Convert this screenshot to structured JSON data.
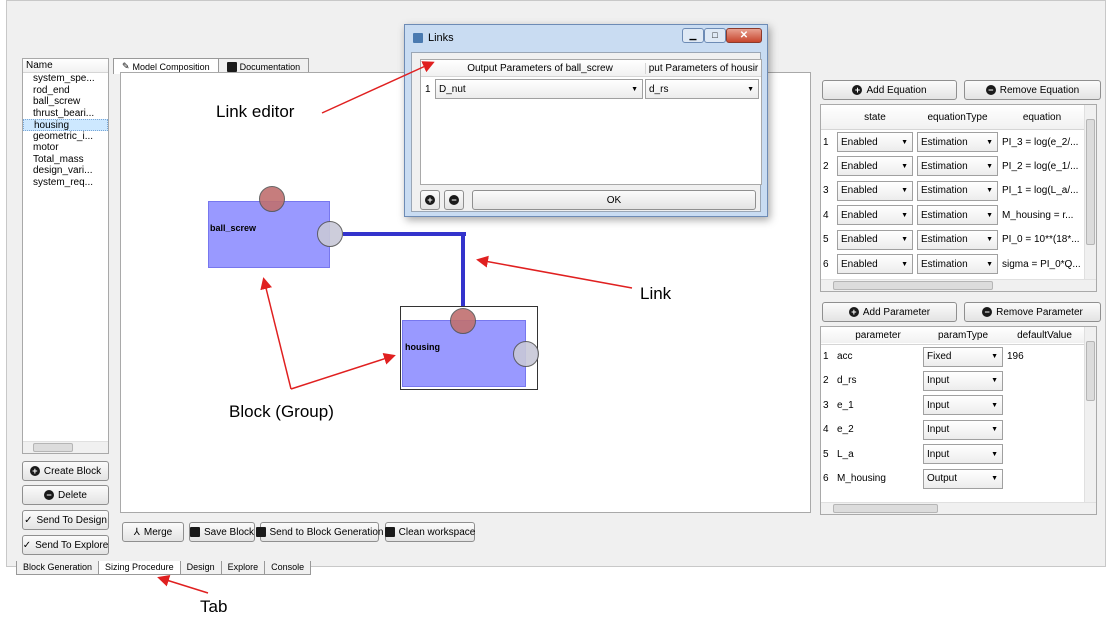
{
  "colors": {
    "block_fill": "#9999ff",
    "link": "#3333cc",
    "annotation": "#e02020",
    "input_port": "#c07070",
    "output_port": "#c8c8d8"
  },
  "logo": {
    "app_icon": "app-logo-icon",
    "brand_icon": "brand-swirl-icon"
  },
  "tree": {
    "header": "Name",
    "items": [
      "system_spe...",
      "rod_end",
      "ball_screw",
      "thrust_beari...",
      "housing",
      "geometric_i...",
      "motor",
      "Total_mass",
      "design_vari...",
      "system_req..."
    ],
    "selected": "housing"
  },
  "left_buttons": {
    "create_block": "Create Block",
    "delete": "Delete",
    "send_design": "Send To Design",
    "send_explore": "Send To Explore"
  },
  "center_tabs": [
    "Model Composition",
    "Documentation"
  ],
  "canvas": {
    "block1": "ball_screw",
    "block2": "housing"
  },
  "toolbar": {
    "merge": "Merge",
    "save_block": "Save Block",
    "send_generation": "Send to Block Generation",
    "clean": "Clean workspace"
  },
  "bottom_tabs": [
    "Block Generation",
    "Sizing Procedure",
    "Design",
    "Explore",
    "Console"
  ],
  "links_dialog": {
    "title": "Links",
    "col1": "Output Parameters of ball_screw",
    "col2": "put Parameters of housir",
    "row_num": "1",
    "out_value": "D_nut",
    "in_value": "d_rs",
    "ok": "OK"
  },
  "equations": {
    "add": "Add Equation",
    "remove": "Remove Equation",
    "headers": [
      "state",
      "equationType",
      "equation"
    ],
    "rows": [
      {
        "n": "1",
        "state": "Enabled",
        "type": "Estimation",
        "eq": "PI_3 = log(e_2/..."
      },
      {
        "n": "2",
        "state": "Enabled",
        "type": "Estimation",
        "eq": "PI_2 = log(e_1/..."
      },
      {
        "n": "3",
        "state": "Enabled",
        "type": "Estimation",
        "eq": "PI_1 = log(L_a/..."
      },
      {
        "n": "4",
        "state": "Enabled",
        "type": "Estimation",
        "eq": "M_housing = r..."
      },
      {
        "n": "5",
        "state": "Enabled",
        "type": "Estimation",
        "eq": "PI_0 = 10**(18*..."
      },
      {
        "n": "6",
        "state": "Enabled",
        "type": "Estimation",
        "eq": "sigma = PI_0*Q..."
      }
    ]
  },
  "parameters": {
    "add": "Add Parameter",
    "remove": "Remove Parameter",
    "headers": [
      "parameter",
      "paramType",
      "defaultValue"
    ],
    "rows": [
      {
        "n": "1",
        "name": "acc",
        "type": "Fixed",
        "default": "196"
      },
      {
        "n": "2",
        "name": "d_rs",
        "type": "Input",
        "default": ""
      },
      {
        "n": "3",
        "name": "e_1",
        "type": "Input",
        "default": ""
      },
      {
        "n": "4",
        "name": "e_2",
        "type": "Input",
        "default": ""
      },
      {
        "n": "5",
        "name": "L_a",
        "type": "Input",
        "default": ""
      },
      {
        "n": "6",
        "name": "M_housing",
        "type": "Output",
        "default": ""
      }
    ]
  },
  "annotations": {
    "link_editor": "Link editor",
    "link": "Link",
    "block_group": "Block (Group)",
    "tab": "Tab"
  }
}
